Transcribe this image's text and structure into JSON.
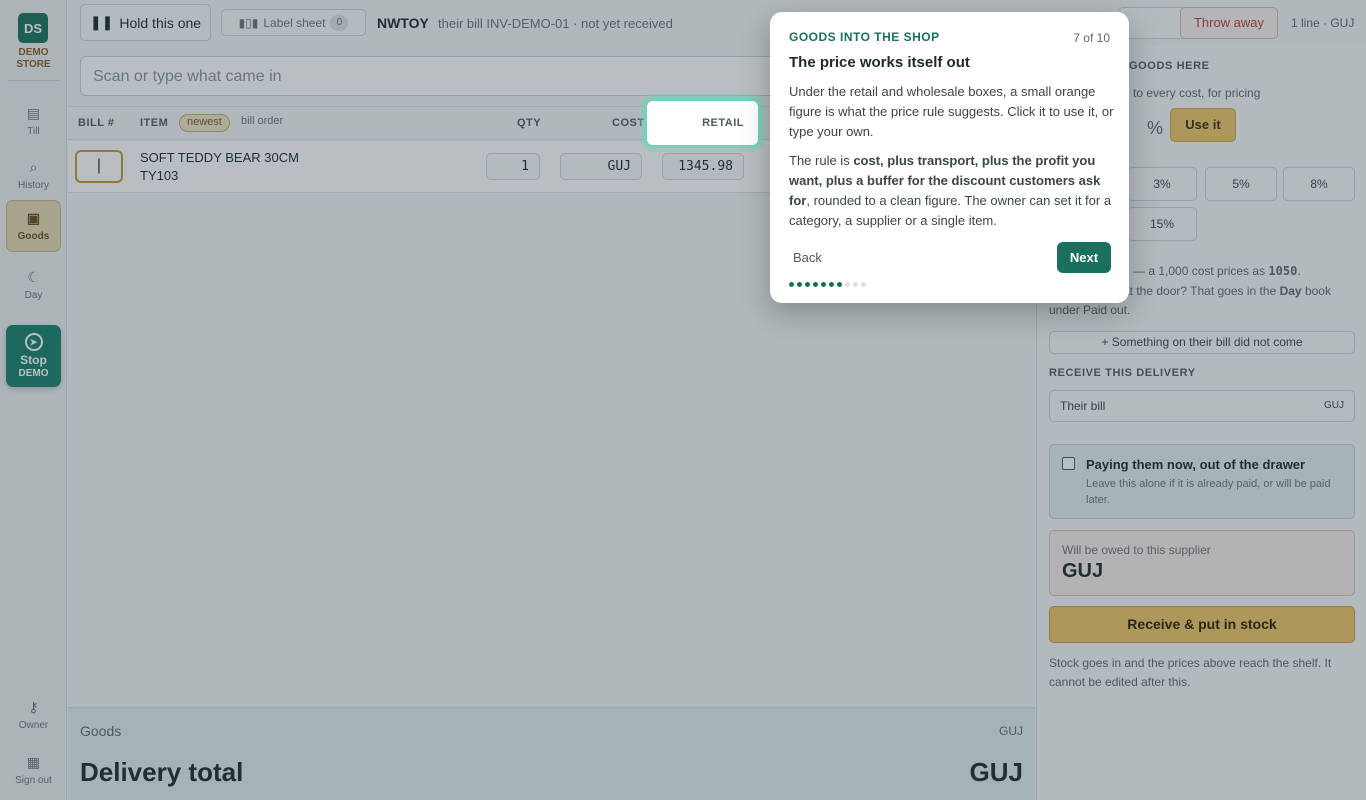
{
  "sidebar": {
    "logo": "DS",
    "store_line1": "DEMO",
    "store_line2": "STORE",
    "items": [
      {
        "label": "Till"
      },
      {
        "label": "History"
      },
      {
        "label": "Goods"
      },
      {
        "label": "Day"
      }
    ],
    "stop_label": "Stop",
    "stop_sub": "DEMO",
    "owner": "Owner",
    "signout": "Sign out"
  },
  "topbar": {
    "hold_label": "Hold this one",
    "label_sheet": "Label sheet",
    "label_count": "0",
    "supplier": "NWTOY",
    "bill_info": "their bill INV-DEMO-01 · not yet received",
    "here_label": "here",
    "throw_label": "Throw away",
    "lines_info": "1 line · GUJ"
  },
  "scan": {
    "placeholder": "Scan or type what came in"
  },
  "table": {
    "headers": {
      "bill": "BILL #",
      "item": "ITEM",
      "newest": "newest",
      "bill_order": "bill order",
      "qty": "QTY",
      "cost": "COST",
      "retail": "RETAIL"
    },
    "rows": [
      {
        "bill": "|",
        "name": "SOFT TEDDY BEAR 30CM",
        "code": "TY103",
        "qty": "1",
        "cost": "GUJ",
        "retail": "1345.98"
      }
    ]
  },
  "right_panel": {
    "section1": "GOODS HERE",
    "cost_hint": "to every cost, for pricing",
    "percent": "%",
    "use_it": "Use it",
    "buffers": [
      "3%",
      "5%",
      "8%",
      "15%"
    ],
    "example_prefix": "— a 1,000 cost prices as",
    "example_value": "1050",
    "door_text": "at the door? That goes in the",
    "door_book": "Day",
    "door_tail": "book",
    "paid_out": "under Paid out.",
    "missing_btn": "+ Something on their bill did not come",
    "section2": "RECEIVE THIS DELIVERY",
    "their_bill": "Their bill",
    "their_bill_cur": "GUJ",
    "pay_now": "Paying them now, out of the drawer",
    "pay_now_hint": "Leave this alone if it is already paid, or will be paid later.",
    "owed_label": "Will be owed to this supplier",
    "owed_value": "GUJ",
    "receive_btn": "Receive & put in stock",
    "stock_note": "Stock goes in and the prices above reach the shelf. It cannot be edited after this."
  },
  "footer": {
    "goods": "Goods",
    "goods_value": "GUJ",
    "total": "Delivery total",
    "total_value": "GUJ"
  },
  "tour": {
    "kicker": "GOODS INTO THE SHOP",
    "step": "7 of 10",
    "title": "The price works itself out",
    "p1": "Under the retail and wholesale boxes, a small orange figure is what the price rule suggests. Click it to use it, or type your own.",
    "p2_lead": "The rule is ",
    "p2_bold": "cost, plus transport, plus the profit you want, plus a buffer for the discount customers ask for",
    "p2_tail": ", rounded to a clean figure. The owner can set it for a category, a supplier or a single item.",
    "back": "Back",
    "next": "Next",
    "total_steps": 10,
    "current_step": 7
  },
  "colors": {
    "accent": "#19705e",
    "warning": "#c8973f",
    "danger": "#b0473a"
  }
}
